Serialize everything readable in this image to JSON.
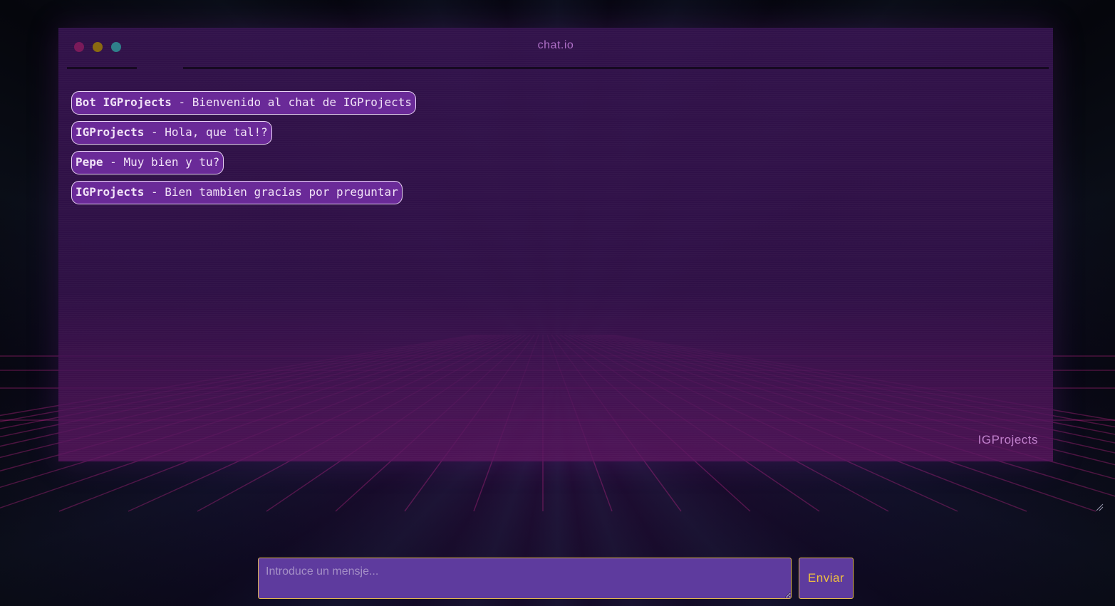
{
  "window": {
    "title": "chat.io",
    "brand": "IGProjects"
  },
  "messages": [
    {
      "author": "Bot IGProjects",
      "separator": " - ",
      "text": "Bienvenido al chat de IGProjects"
    },
    {
      "author": "IGProjects",
      "separator": " - ",
      "text": "Hola, que tal!?"
    },
    {
      "author": "Pepe",
      "separator": " - ",
      "text": "Muy bien y tu?"
    },
    {
      "author": "IGProjects",
      "separator": " - ",
      "text": "Bien tambien gracias por preguntar"
    }
  ],
  "composer": {
    "placeholder": "Introduce un mensje...",
    "value": "",
    "send_label": "Enviar"
  },
  "colors": {
    "window_dot_red": "#7a1a5a",
    "window_dot_yellow": "#8a6a10",
    "window_dot_teal": "#2f7f8a",
    "message_bubble": "#6a2a98",
    "accent_border": "#e0b650",
    "send_text": "#f0c040"
  }
}
